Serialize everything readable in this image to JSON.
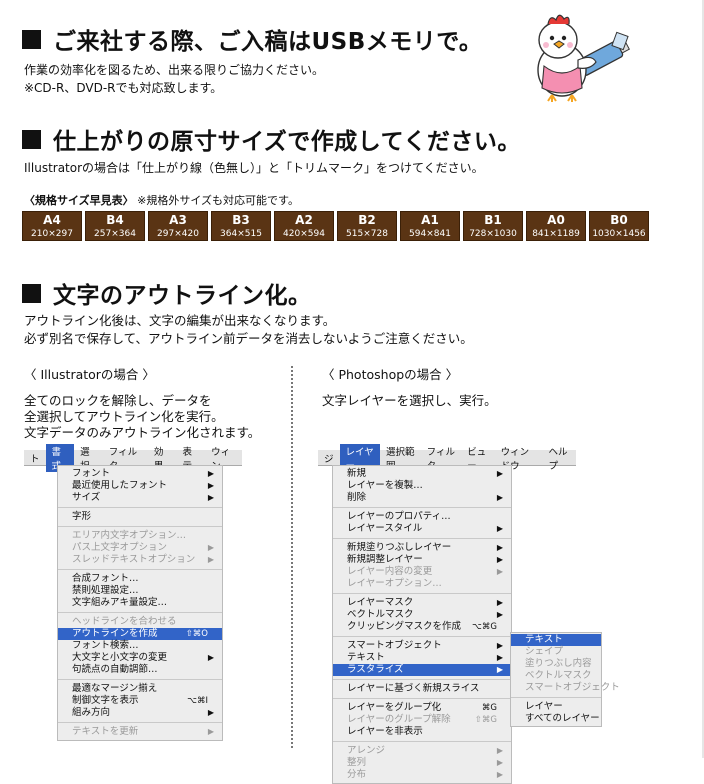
{
  "section1": {
    "heading": "ご来社する際、ご入稿はUSBメモリで。",
    "lines": [
      "作業の効率化を図るため、出来る限りご協力ください。",
      "※CD-R、DVD-Rでも対応致します。"
    ]
  },
  "section2": {
    "heading": "仕上がりの原寸サイズで作成してください。",
    "note": "Illustratorの場合は「仕上がり線（色無し）」と「トリムマーク」をつけてください。",
    "table_label": "〈規格サイズ早見表〉",
    "table_note": "※規格外サイズも対応可能です。",
    "sizes": [
      {
        "name": "A4",
        "dim": "210×297"
      },
      {
        "name": "B4",
        "dim": "257×364"
      },
      {
        "name": "A3",
        "dim": "297×420"
      },
      {
        "name": "B3",
        "dim": "364×515"
      },
      {
        "name": "A2",
        "dim": "420×594"
      },
      {
        "name": "B2",
        "dim": "515×728"
      },
      {
        "name": "A1",
        "dim": "594×841"
      },
      {
        "name": "B1",
        "dim": "728×1030"
      },
      {
        "name": "A0",
        "dim": "841×1189"
      },
      {
        "name": "B0",
        "dim": "1030×1456"
      }
    ],
    "size_color": "#5a3414"
  },
  "section3": {
    "heading": "文字のアウトライン化。",
    "lines": [
      "アウトライン化後は、文字の編集が出来なくなります。",
      "必ず別名で保存して、アウトライン前データを消去しないようご注意ください。"
    ]
  },
  "illustrator": {
    "title": "〈 Illustratorの場合 〉",
    "lines": [
      "全てのロックを解除し、データを",
      "全選択してアウトライン化を実行。",
      "文字データのみアウトライン化されます。"
    ],
    "menubar": [
      "ト",
      "書式",
      "選択",
      "フィルタ",
      "効果",
      "表示",
      "ウィン"
    ],
    "items": [
      {
        "label": "フォント",
        "arrow": "▶"
      },
      {
        "label": "最近使用したフォント",
        "arrow": "▶"
      },
      {
        "label": "サイズ",
        "arrow": "▶"
      },
      {
        "sep": true
      },
      {
        "label": "字形"
      },
      {
        "sep": true
      },
      {
        "label": "エリア内文字オプション…",
        "dis": true
      },
      {
        "label": "パス上文字オプション",
        "dis": true,
        "arrow": "▶"
      },
      {
        "label": "スレッドテキストオプション",
        "dis": true,
        "arrow": "▶"
      },
      {
        "sep": true
      },
      {
        "label": "合成フォント…"
      },
      {
        "label": "禁則処理設定…"
      },
      {
        "label": "文字組みアキ量設定…"
      },
      {
        "sep": true
      },
      {
        "label": "ヘッドラインを合わせる",
        "dis": true
      },
      {
        "label": "アウトラインを作成",
        "hl": true,
        "sc": "⇧⌘O"
      },
      {
        "label": "フォント検索…"
      },
      {
        "label": "大文字と小文字の変更",
        "arrow": "▶"
      },
      {
        "label": "句読点の自動調節…"
      },
      {
        "sep": true
      },
      {
        "label": "最適なマージン揃え"
      },
      {
        "label": "制御文字を表示",
        "sc": "⌥⌘I"
      },
      {
        "label": "組み方向",
        "arrow": "▶"
      },
      {
        "sep": true
      },
      {
        "label": "テキストを更新",
        "dis": true,
        "arrow": "▶"
      }
    ]
  },
  "photoshop": {
    "title": "〈 Photoshopの場合 〉",
    "lines": [
      "文字レイヤーを選択し、実行。"
    ],
    "menubar": [
      "ジ",
      "レイヤー",
      "選択範囲",
      "フィルタ",
      "ビュー",
      "ウィンドウ",
      "ヘルプ"
    ],
    "items": [
      {
        "label": "新規",
        "arrow": "▶"
      },
      {
        "label": "レイヤーを複製…"
      },
      {
        "label": "削除",
        "arrow": "▶"
      },
      {
        "sep": true
      },
      {
        "label": "レイヤーのプロパティ…"
      },
      {
        "label": "レイヤースタイル",
        "arrow": "▶"
      },
      {
        "sep": true
      },
      {
        "label": "新規塗りつぶしレイヤー",
        "arrow": "▶"
      },
      {
        "label": "新規調整レイヤー",
        "arrow": "▶"
      },
      {
        "label": "レイヤー内容の変更",
        "dis": true,
        "arrow": "▶"
      },
      {
        "label": "レイヤーオプション…",
        "dis": true
      },
      {
        "sep": true
      },
      {
        "label": "レイヤーマスク",
        "arrow": "▶"
      },
      {
        "label": "ベクトルマスク",
        "arrow": "▶"
      },
      {
        "label": "クリッピングマスクを作成",
        "sc": "⌥⌘G"
      },
      {
        "sep": true
      },
      {
        "label": "スマートオブジェクト",
        "arrow": "▶"
      },
      {
        "label": "テキスト",
        "arrow": "▶"
      },
      {
        "label": "ラスタライズ",
        "hl": true,
        "arrow": "▶"
      },
      {
        "sep": true
      },
      {
        "label": "レイヤーに基づく新規スライス"
      },
      {
        "sep": true
      },
      {
        "label": "レイヤーをグループ化",
        "sc": "⌘G"
      },
      {
        "label": "レイヤーのグループ解除",
        "dis": true,
        "sc": "⇧⌘G"
      },
      {
        "label": "レイヤーを非表示"
      },
      {
        "sep": true
      },
      {
        "label": "アレンジ",
        "dis": true,
        "arrow": "▶"
      },
      {
        "label": "整列",
        "dis": true,
        "arrow": "▶"
      },
      {
        "label": "分布",
        "dis": true,
        "arrow": "▶"
      }
    ],
    "submenu": [
      {
        "label": "テキスト",
        "hl": true
      },
      {
        "label": "シェイプ",
        "dis": true
      },
      {
        "label": "塗りつぶし内容",
        "dis": true
      },
      {
        "label": "ベクトルマスク",
        "dis": true
      },
      {
        "label": "スマートオブジェクト",
        "dis": true
      },
      {
        "sep": true
      },
      {
        "label": "レイヤー"
      },
      {
        "label": "すべてのレイヤー"
      }
    ]
  }
}
